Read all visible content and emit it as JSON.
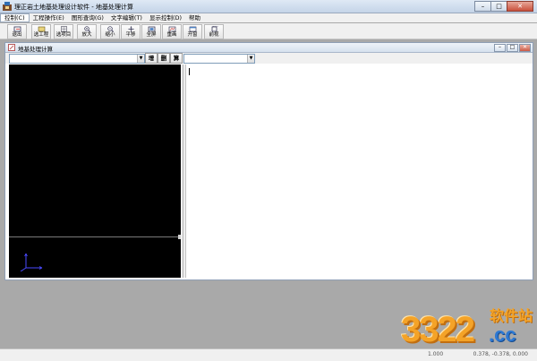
{
  "window": {
    "title": "理正岩土地基处理设计软件 - 地基处理计算",
    "min_glyph": "–",
    "max_glyph": "□",
    "close_glyph": "✕"
  },
  "menu": [
    {
      "label": "控制(C)"
    },
    {
      "label": "工程操作(E)"
    },
    {
      "label": "图形查询(G)"
    },
    {
      "label": "文字编辑(T)"
    },
    {
      "label": "显示控制(D)"
    },
    {
      "label": "帮助"
    }
  ],
  "toolbar": [
    {
      "label": "退出",
      "icon": "exit-icon"
    },
    {
      "label": "选工程",
      "icon": "project-icon"
    },
    {
      "label": "选项目",
      "icon": "item-icon"
    },
    {
      "label": "放大",
      "icon": "zoom-in-icon"
    },
    {
      "label": "缩小",
      "icon": "zoom-out-icon"
    },
    {
      "label": "平移",
      "icon": "pan-icon"
    },
    {
      "label": "全屏",
      "icon": "fullscreen-icon"
    },
    {
      "label": "重画",
      "icon": "redraw-icon"
    },
    {
      "label": "开窗",
      "icon": "window-icon"
    },
    {
      "label": "前视",
      "icon": "front-view-icon"
    }
  ],
  "child": {
    "title": "地基处理计算",
    "left_combo_value": "",
    "right_combo_value": "",
    "btn_add": "增",
    "btn_delete": "删",
    "btn_calc": "算"
  },
  "status": {
    "scale": "1.000",
    "coords": "0.378, -0.378, 0.000"
  },
  "watermark": {
    "number": "3322",
    "site": "软件站",
    "domain": ".cc"
  }
}
